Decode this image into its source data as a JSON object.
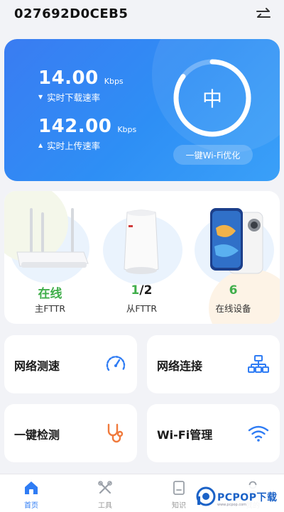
{
  "header": {
    "device_id": "027692D0CEB5"
  },
  "speed": {
    "download_value": "14.00",
    "download_unit": "Kbps",
    "download_label": "实时下载速率",
    "upload_value": "142.00",
    "upload_unit": "Kbps",
    "upload_label": "实时上传速率",
    "quality": "中",
    "quality_level": 0.85,
    "optimize_label": "一键Wi-Fi优化"
  },
  "devices": {
    "main": {
      "status": "在线",
      "label": "主FTTR",
      "status_color": "#3fae4a"
    },
    "sub": {
      "status_current": "1",
      "status_total": "/2",
      "label": "从FTTR"
    },
    "online": {
      "count": "6",
      "label": "在线设备",
      "status_color": "#3fae4a"
    }
  },
  "tiles": {
    "speedtest": {
      "label": "网络测速",
      "icon": "speedometer-icon"
    },
    "connection": {
      "label": "网络连接",
      "icon": "network-topology-icon"
    },
    "diagnose": {
      "label": "一键检测",
      "icon": "stethoscope-icon"
    },
    "wifi": {
      "label": "Wi-Fi管理",
      "icon": "wifi-icon"
    }
  },
  "tabs": [
    {
      "label": "首页",
      "icon": "home-icon",
      "active": true
    },
    {
      "label": "工具",
      "icon": "tools-icon",
      "active": false
    },
    {
      "label": "知识",
      "icon": "knowledge-icon",
      "active": false
    },
    {
      "label": "我的",
      "icon": "profile-icon",
      "active": false
    }
  ],
  "watermark": {
    "text": "PCPOP下载",
    "subtext": "www.pcpop.com"
  },
  "colors": {
    "accent": "#2f7cf4",
    "card_gradient_start": "#3a7cf2",
    "online_green": "#3fae4a",
    "tile_icon_blue": "#2f7cf4",
    "tile_icon_orange": "#f07a3c"
  }
}
